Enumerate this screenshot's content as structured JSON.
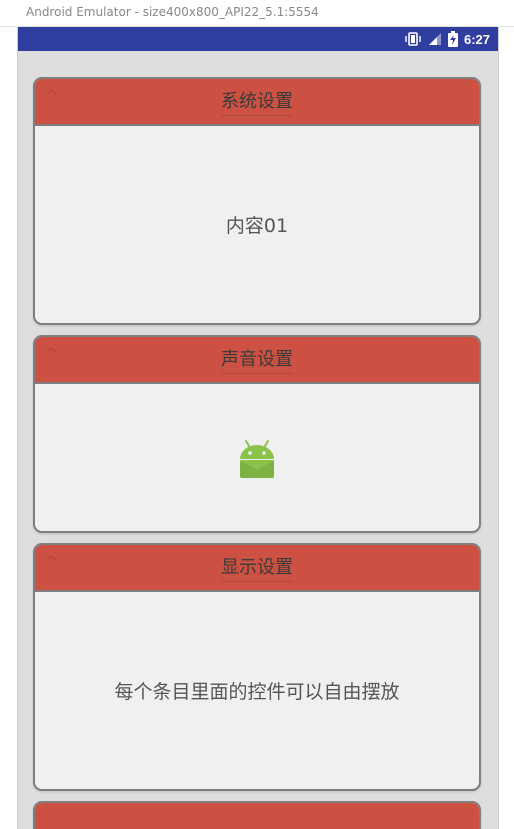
{
  "window": {
    "title": "Android Emulator - size400x800_API22_5.1:5554"
  },
  "statusbar": {
    "time": "6:27",
    "icons": [
      "vibrate-icon",
      "signal-icon",
      "battery-charging-icon"
    ],
    "background_color": "#303f9f"
  },
  "accordion": {
    "header_color": "#cc5143",
    "panels": [
      {
        "title": "系统设置",
        "content": "内容01",
        "expanded": true
      },
      {
        "title": "声音设置",
        "content_icon": "android-robot-icon",
        "expanded": true
      },
      {
        "title": "显示设置",
        "content": "每个条目里面的控件可以自由摆放",
        "expanded": true
      },
      {
        "title": "",
        "expanded": false
      }
    ]
  }
}
